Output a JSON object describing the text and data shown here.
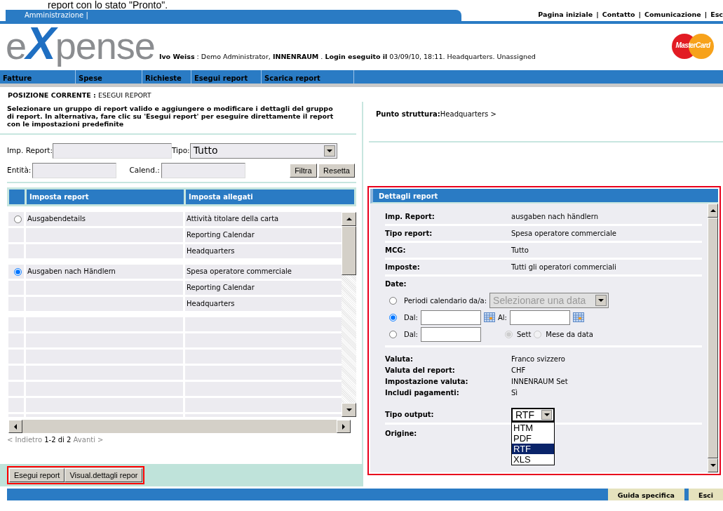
{
  "caption_fragment": "report con lo stato \"Pronto\".",
  "admin_tab": "Amministrazione |",
  "top_links": [
    {
      "kind": "link",
      "text": "Pagina iniziale"
    },
    {
      "kind": "separator",
      "text": "|"
    },
    {
      "kind": "link",
      "text": "Contatto"
    },
    {
      "kind": "separator",
      "text": "|"
    },
    {
      "kind": "link",
      "text": "Comunicazione"
    },
    {
      "kind": "separator",
      "text": "|"
    },
    {
      "kind": "link",
      "text": "Esc"
    }
  ],
  "logo": {
    "start": "e",
    "mark": "X",
    "end": "pense"
  },
  "card_logo": "MasterCard",
  "user_info": "**Ivo Weiss** : Demo Administrator, **INNENRAUM** . **Login eseguito il** 03/09/10, 18:11. Headquarters. Unassigned",
  "menu": [
    "Fatture",
    "Spese",
    "Richieste",
    "Esegui report",
    "Scarica report"
  ],
  "breadcrumb": "**POSIZIONE CORRENTE :** ESEGUI REPORT",
  "instructions": "Selezionare un gruppo di report valido e aggiungere o modificare i dettagli del gruppo di report. In alternativa, fare clic su 'Esegui report' per eseguire direttamente il report con le impostazioni predefinite",
  "filters": {
    "report_label": "Imp. Report:",
    "type_label": "Tipo:",
    "type_value": "Tutto",
    "entity_label": "Entità:",
    "calendar_label": "Calend.:"
  },
  "filter_buttons": [
    "Filtra",
    "Resetta"
  ],
  "table": {
    "columns": [
      "Imposta report",
      "Imposta allegati"
    ],
    "groups": [
      {
        "name": "Ausgabendetails",
        "selected": false,
        "attachments": [
          "Attività titolare della carta",
          "Reporting Calendar",
          "Headquarters"
        ]
      },
      {
        "name": "Ausgaben nach Händlern",
        "selected": true,
        "attachments": [
          "Spesa operatore commerciale",
          "Reporting Calendar",
          "Headquarters"
        ]
      }
    ]
  },
  "pager": "< Indietro **1-2 di 2** Avanti >",
  "action_buttons": [
    "Esegui report",
    "Visual.dettagli repor"
  ],
  "structure_point": "**Punto struttura:**Headquarters >",
  "details_panel": {
    "title": "Dettagli report",
    "fields": [
      {
        "label": "Imp. Report:",
        "value": "ausgaben nach händlern"
      },
      {
        "label": "Tipo report:",
        "value": "Spesa operatore commerciale"
      },
      {
        "label": "MCG:",
        "value": "Tutto"
      },
      {
        "label": "Imposte:",
        "value": "Tutti gli operatori commerciali"
      }
    ],
    "dates": {
      "label": "Date:",
      "options": [
        {
          "kind": "calendar",
          "selected": false,
          "label": "Periodi calendario da/a:",
          "placeholder": "Selezionare una data"
        },
        {
          "kind": "range",
          "selected": true,
          "from_label": "Dal:",
          "to_label": "Al:"
        },
        {
          "kind": "relative",
          "selected": false,
          "from_label": "Dal:",
          "choices": [
            {
              "label": "Sett",
              "selected": true
            },
            {
              "label": "Mese da data",
              "selected": false
            }
          ]
        }
      ]
    },
    "currency_fields": [
      {
        "label": "Valuta:",
        "value": "Franco svizzero"
      },
      {
        "label": "Valuta del report:",
        "value": "CHF"
      },
      {
        "label": "Impostazione valuta:",
        "value": "INNENRAUM Set"
      },
      {
        "label": "Includi pagamenti:",
        "value": "Sì"
      }
    ],
    "output": {
      "label": "Tipo output:",
      "value": "RTF",
      "options": [
        {
          "label": "HTM",
          "selected": false
        },
        {
          "label": "PDF",
          "selected": false
        },
        {
          "label": "RTF",
          "selected": true
        },
        {
          "label": "XLS",
          "selected": false
        }
      ]
    },
    "origin_label": "Origine:"
  },
  "footer_buttons": [
    "Guida specifica",
    "Esci"
  ]
}
